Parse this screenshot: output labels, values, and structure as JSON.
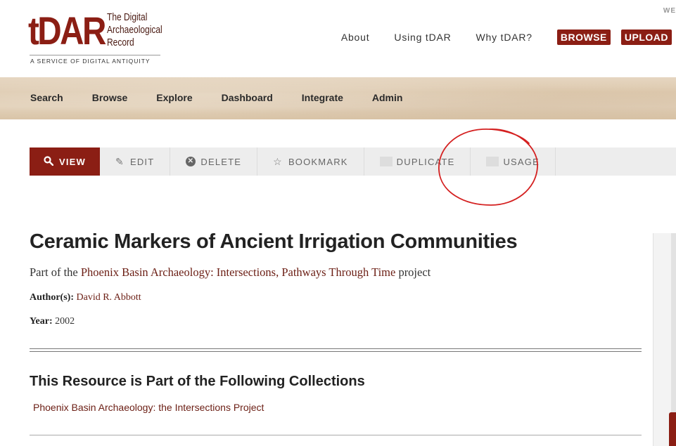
{
  "header": {
    "logo": {
      "mark": "tDAR",
      "lines": [
        "The Digital",
        "Archaeological",
        "Record"
      ],
      "tagline": "A SERVICE OF DIGITAL ANTIQUITY"
    },
    "corner_text": "WE",
    "nav_links": [
      "About",
      "Using tDAR",
      "Why tDAR?"
    ],
    "browse_label": "BROWSE",
    "upload_label": "UPLOAD"
  },
  "main_nav": [
    "Search",
    "Browse",
    "Explore",
    "Dashboard",
    "Integrate",
    "Admin"
  ],
  "toolbar": {
    "view": "VIEW",
    "edit": "EDIT",
    "delete": "DELETE",
    "bookmark": "BOOKMARK",
    "duplicate": "DUPLICATE",
    "usage": "USAGE"
  },
  "resource": {
    "title": "Ceramic Markers of Ancient Irrigation Communities",
    "part_of_prefix": "Part of the ",
    "project_link": "Phoenix Basin Archaeology: Intersections, Pathways Through Time",
    "part_of_suffix": " project",
    "authors_label": "Author(s):",
    "author": "David R. Abbott",
    "year_label": "Year:",
    "year": "2002"
  },
  "collections": {
    "heading": "This Resource is Part of the Following Collections",
    "items": [
      "Phoenix Basin Archaeology: the Intersections Project"
    ]
  },
  "colors": {
    "brand": "#8b1e14",
    "annotation": "#d42020"
  }
}
